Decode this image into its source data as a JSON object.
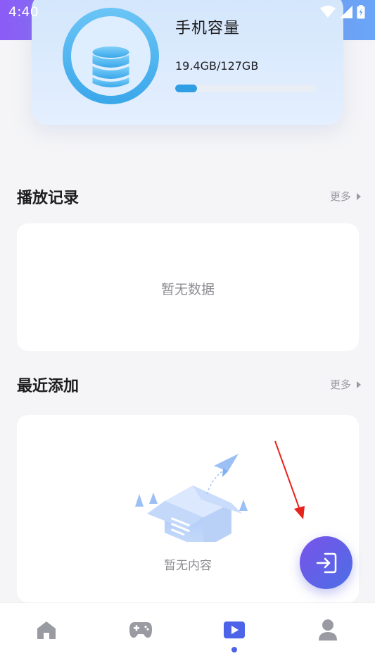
{
  "status_bar": {
    "time": "4:40"
  },
  "storage": {
    "title": "手机容量",
    "usage": "19.4GB/127GB",
    "used_fraction": 0.153
  },
  "play_history": {
    "title": "播放记录",
    "more": "更多",
    "empty_text": "暂无数据"
  },
  "recently_added": {
    "title": "最近添加",
    "more": "更多",
    "empty_text": "暂无内容"
  },
  "fab": {
    "icon": "import-icon"
  },
  "nav": {
    "items": [
      {
        "icon": "home-icon"
      },
      {
        "icon": "gamepad-icon"
      },
      {
        "icon": "video-play-icon",
        "active": true
      },
      {
        "icon": "user-icon"
      }
    ]
  },
  "colors": {
    "accent": "#4d63e8",
    "ring": "#3aa7ea",
    "progress": "#2f9ee3",
    "annotation_arrow": "#e8221c"
  }
}
